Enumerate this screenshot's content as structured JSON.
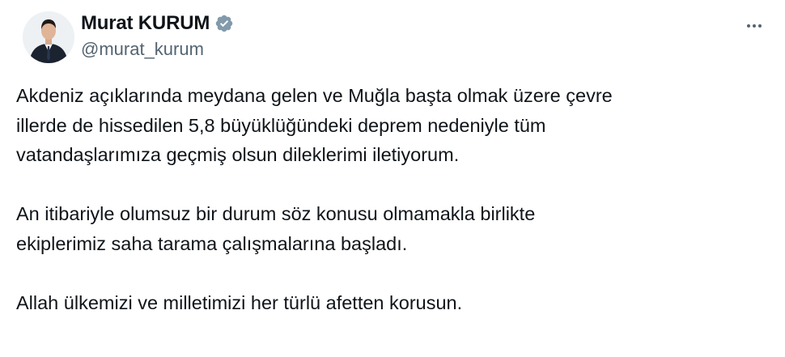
{
  "author": {
    "display_name": "Murat KURUM",
    "handle": "@murat_kurum",
    "verified_icon": "verified-badge-icon",
    "badge_color": "#829aab"
  },
  "actions": {
    "more_icon": "more-horizontal-icon"
  },
  "tweet": {
    "paragraph_1": [
      "Akdeniz açıklarında meydana gelen ve Muğla başta olmak üzere çevre",
      "illerde de hissedilen 5,8 büyüklüğündeki deprem nedeniyle tüm",
      "vatandaşlarımıza geçmiş olsun dileklerimi iletiyorum."
    ],
    "paragraph_2": [
      "An itibariyle olumsuz bir durum söz konusu olmamakla birlikte",
      "ekiplerimiz saha tarama çalışmalarına başladı."
    ],
    "paragraph_3": [
      "Allah ülkemizi ve milletimizi her türlü afetten korusun."
    ]
  },
  "colors": {
    "text": "#0f1419",
    "secondary": "#536471",
    "background": "#ffffff"
  }
}
